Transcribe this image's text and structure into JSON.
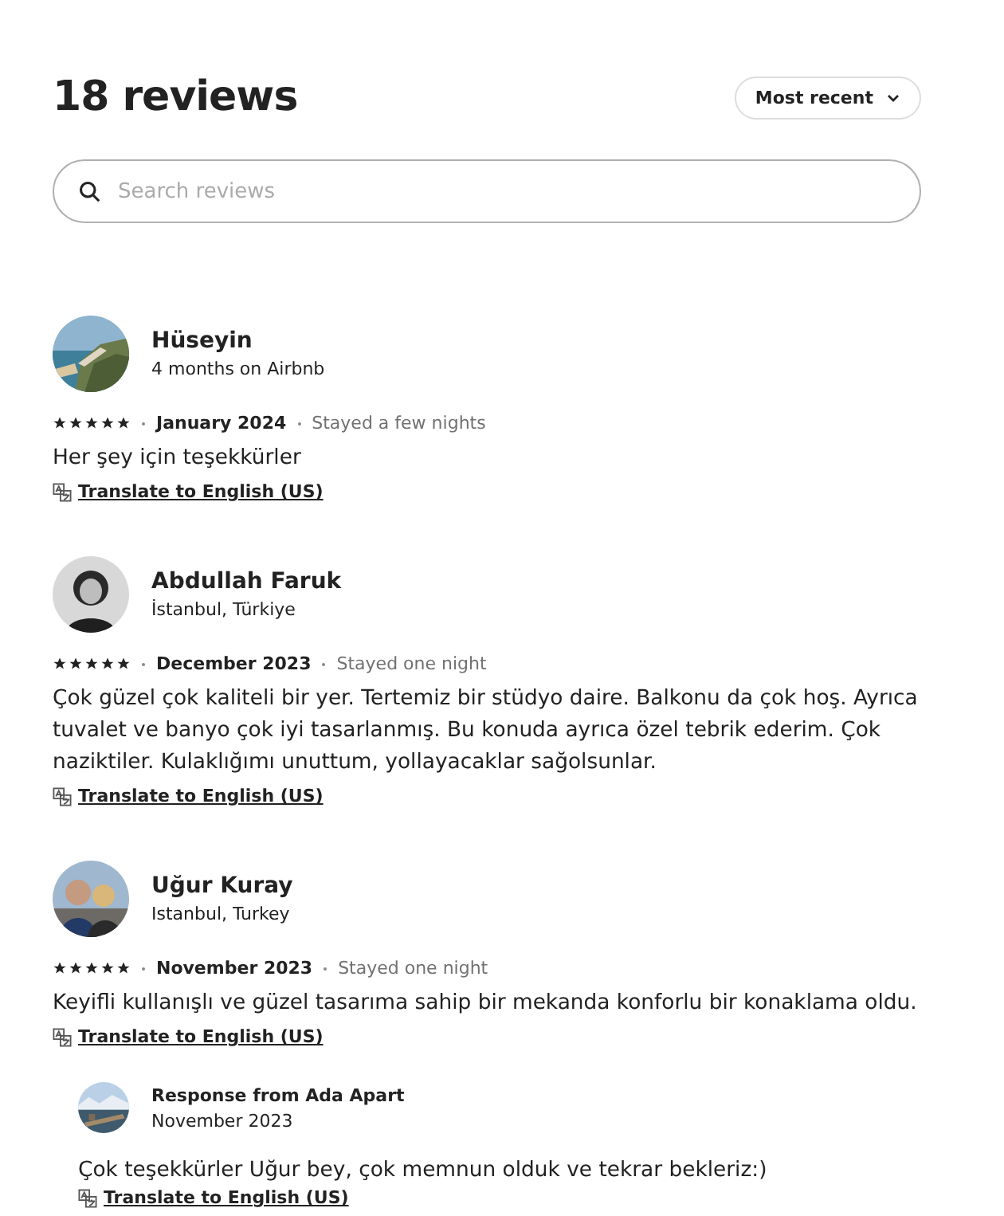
{
  "title": "18 reviews",
  "sort": {
    "label": "Most recent"
  },
  "search": {
    "placeholder": "Search reviews"
  },
  "reviews": [
    {
      "name": "Hüseyin",
      "subtitle": "4 months on Airbnb",
      "stars": 5,
      "date": "January 2024",
      "stay": "Stayed a few nights",
      "text": "Her şey için teşekkürler",
      "translate": "Translate to English (US)"
    },
    {
      "name": "Abdullah Faruk",
      "subtitle": "İstanbul, Türkiye",
      "stars": 5,
      "date": "December 2023",
      "stay": "Stayed one night",
      "text": "Çok güzel çok kaliteli bir yer. Tertemiz bir stüdyo daire. Balkonu da çok hoş. Ayrıca tuvalet ve banyo çok iyi tasarlanmış. Bu konuda ayrıca özel tebrik ederim. Çok naziktiler. Kulaklığımı unuttum, yollayacaklar sağolsunlar.",
      "translate": "Translate to English (US)"
    },
    {
      "name": "Uğur Kuray",
      "subtitle": "Istanbul, Turkey",
      "stars": 5,
      "date": "November 2023",
      "stay": "Stayed one night",
      "text": "Keyifli kullanışlı ve güzel tasarıma sahip bir mekanda konforlu bir konaklama oldu.",
      "translate": "Translate to English (US)",
      "response": {
        "title": "Response from Ada Apart",
        "date": "November 2023",
        "text": "Çok teşekkürler Uğur bey, çok memnun olduk ve tekrar bekleriz:)",
        "translate": "Translate to English (US)"
      }
    }
  ]
}
